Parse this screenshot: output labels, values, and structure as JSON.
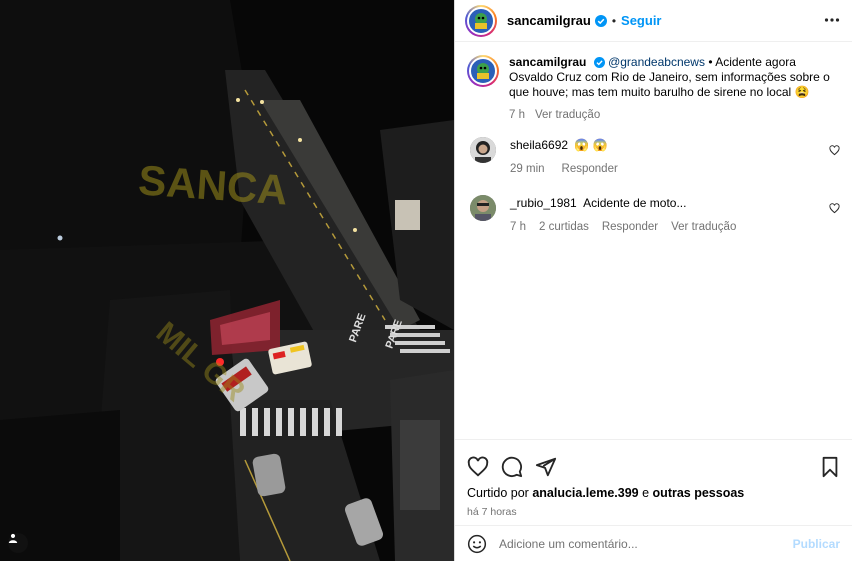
{
  "post": {
    "username": "sancamilgrau",
    "follow_label": "Seguir",
    "separator": "•",
    "watermark_top": "SANCA",
    "watermark_bottom": "MIL GR",
    "road_marking_1": "PARE",
    "road_marking_2": "PARE"
  },
  "caption": {
    "username": "sancamilgrau",
    "mention": "@grandeabcnews",
    "text": " • Acidente agora Osvaldo Cruz com Rio de Janeiro, sem informações sobre o que houve; mas tem muito barulho de sirene no local 😫",
    "time": "7 h",
    "translate": "Ver tradução"
  },
  "comments": [
    {
      "username": "sheila6692",
      "text": "😱 😱",
      "time": "29 min",
      "reply": "Responder"
    },
    {
      "username": "_rubio_1981",
      "text": "Acidente de moto...",
      "time": "7 h",
      "likes": "2 curtidas",
      "reply": "Responder",
      "translate": "Ver tradução"
    }
  ],
  "likes": {
    "prefix": "Curtido por ",
    "user": "analucia.leme.399",
    "middle": " e ",
    "others": "outras pessoas"
  },
  "posted_ago": "há 7 horas",
  "comment_box": {
    "placeholder": "Adicione um comentário...",
    "publish": "Publicar"
  },
  "colors": {
    "link": "#0095f6",
    "verified": "#0095f6",
    "muted": "#737373",
    "publish_disabled": "#b3dbff"
  },
  "icons": [
    "verified-icon",
    "more-options-icon",
    "heart-icon",
    "comment-icon",
    "share-icon",
    "bookmark-icon",
    "emoji-icon",
    "user-tag-icon"
  ]
}
